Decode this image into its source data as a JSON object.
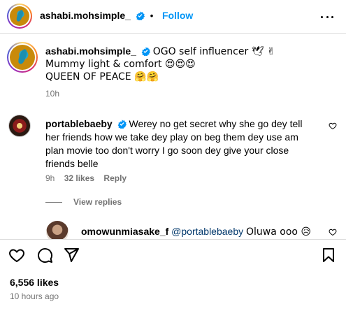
{
  "header": {
    "username": "ashabi.mohsimple_",
    "separator": "•",
    "follow_label": "Follow"
  },
  "caption": {
    "username": "ashabi.mohsimple_",
    "line1": "OGO self influencer 🕊 ✌",
    "line2": "Mummy light & comfort 😍😍😍",
    "line3": "QUEEN OF PEACE 🤗🤗",
    "time": "10h"
  },
  "comments": [
    {
      "username": "portablebaeby",
      "text": "Werey no get secret why she go dey tell her friends how we take dey play on beg them dey use am plan movie too don't worry I go soon dey give your close friends belle",
      "time": "9h",
      "likes": "32 likes",
      "reply_label": "Reply",
      "view_replies": "View replies"
    },
    {
      "username": "omowunmiasake_f",
      "mention": "@portablebaeby",
      "text": "Oluwa ooo 😥"
    }
  ],
  "actions": {
    "likes": "6,556 likes",
    "ago": "10 hours ago"
  },
  "colors": {
    "accent": "#0095f6",
    "muted": "#737373",
    "verified": "#0095f6",
    "divider": "#dbdbdb"
  }
}
